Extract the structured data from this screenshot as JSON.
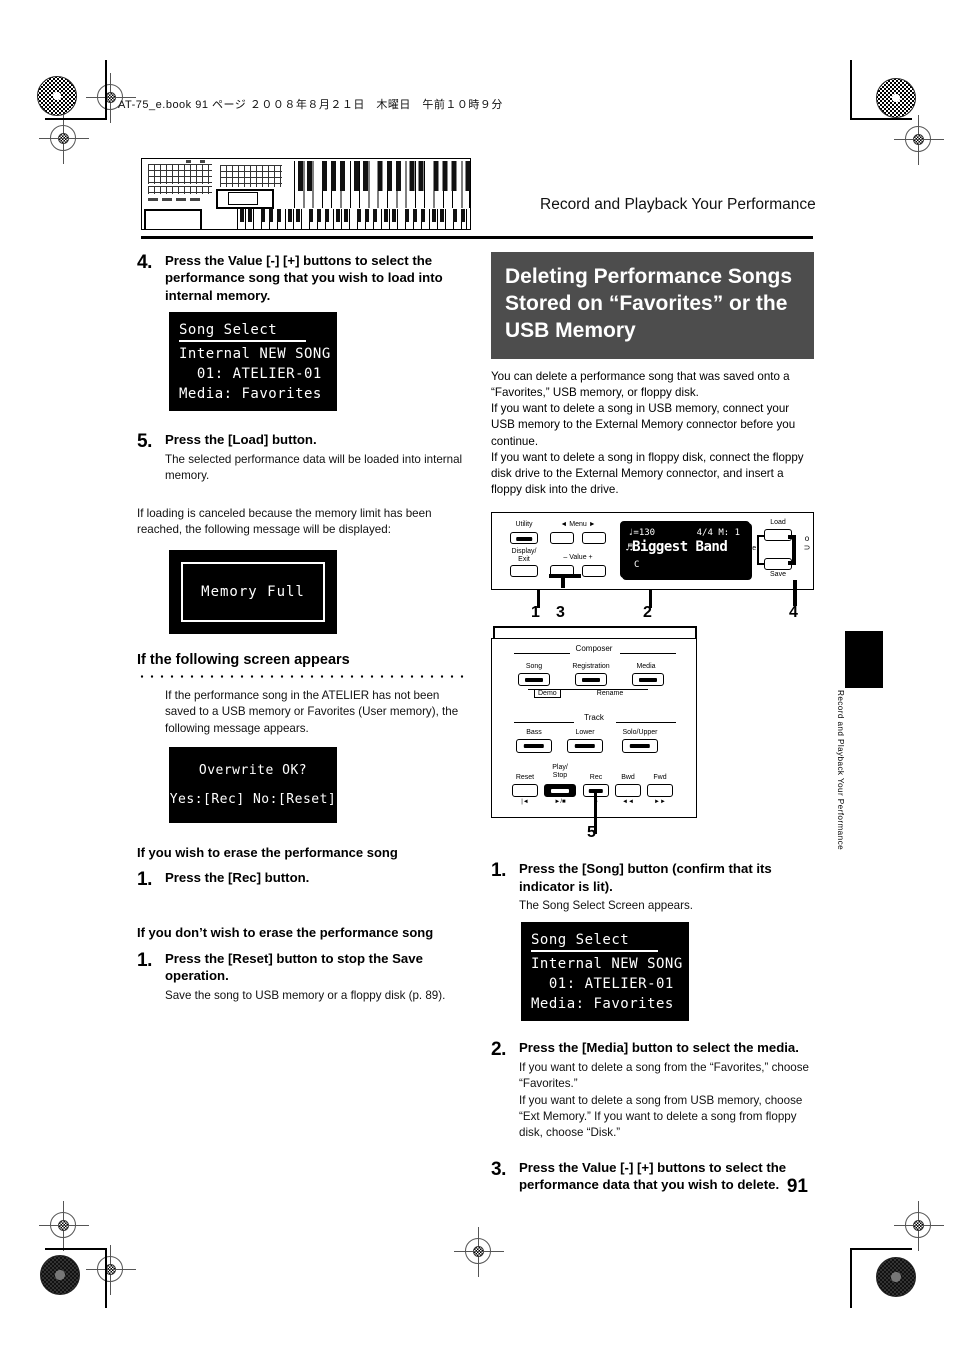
{
  "print_header": "AT-75_e.book 91 ページ ２００８年８月２１日　木曜日　午前１０時９分",
  "running_header": "Record and Playback Your Performance",
  "side_tab_text": "Record and Playback Your Performance",
  "page_number": "91",
  "left_column": {
    "step4": {
      "num": "4.",
      "title": "Press the Value [-] [+] buttons to select the performance song that you wish to load into internal memory."
    },
    "song_select_lcd": {
      "title": "Song Select",
      "line1": "Internal NEW SONG",
      "line2": "  01: ATELIER-01",
      "line3": "Media: Favorites"
    },
    "step5": {
      "num": "5.",
      "title": "Press the [Load] button.",
      "note": "The selected performance data will be loaded into internal memory."
    },
    "memory_full_para": "If loading is canceled because the memory limit has been reached, the following message will be displayed:",
    "memory_full_lcd": "Memory Full",
    "subhead_screen": "If the following screen appears",
    "screen_para": "If the performance song in the ATELIER has not been saved to a USB memory or Favorites (User memory), the following message appears.",
    "overwrite_lcd": {
      "line1": "Overwrite OK?",
      "line2": "Yes:[Rec] No:[Reset]"
    },
    "subhead_erase": "If you wish to erase the performance song",
    "erase_step": {
      "num": "1.",
      "title": "Press the [Rec] button."
    },
    "subhead_noerase": "If you don’t wish to erase the performance song",
    "noerase_step": {
      "num": "1.",
      "title": "Press the [Reset] button to stop the Save operation.",
      "note": "Save the song to USB memory or a floppy disk (p. 89)."
    }
  },
  "right_column": {
    "banner": {
      "line1": "Deleting Performance Songs",
      "line2": "Stored on “Favorites” or the",
      "line3": "USB Memory"
    },
    "intro": {
      "p1": "You can delete a performance song that was saved onto a “Favorites,” USB memory, or floppy disk.",
      "p2": "If you want to delete a song in USB memory, connect your USB memory to the External Memory connector before you continue.",
      "p3": "If you want to delete a song in floppy disk, connect the floppy disk drive to the External Memory connector, and insert a floppy disk into the drive."
    },
    "panel_top": {
      "labels": {
        "utility": "Utility",
        "menu": "Menu",
        "menu_left": "◄",
        "menu_right": "►",
        "display_exit": "Display/\nExit",
        "value": "– Value +",
        "load": "Load",
        "delete": "Delete",
        "save": "Save"
      },
      "lcd": {
        "tempo": "♩=130",
        "beat": "4/4 M:   1",
        "song": "Biggest Band",
        "chord": "C"
      }
    },
    "callouts": [
      "1",
      "3",
      "2",
      "4",
      "5"
    ],
    "panel_bottom": {
      "composer_title": "Composer",
      "composer_buttons": [
        "Song",
        "Registration",
        "Media"
      ],
      "demo_label": "Demo",
      "rename_label": "Rename",
      "track_title": "Track",
      "track_buttons": [
        "Bass",
        "Lower",
        "Solo/Upper"
      ],
      "transport": [
        {
          "label": "Reset",
          "sym": "|◄"
        },
        {
          "label": "Play/\nStop",
          "sym": "►/■"
        },
        {
          "label": "Rec",
          "sym": "●"
        },
        {
          "label": "Bwd",
          "sym": "◄◄"
        },
        {
          "label": "Fwd",
          "sym": "►►"
        }
      ]
    },
    "step1": {
      "num": "1.",
      "title": "Press the [Song] button (confirm that its indicator is lit).",
      "note": "The Song Select Screen appears."
    },
    "song_select_lcd": {
      "title": "Song Select",
      "line1": "Internal NEW SONG",
      "line2": "  01: ATELIER-01",
      "line3": "Media: Favorites"
    },
    "step2": {
      "num": "2.",
      "title": "Press the [Media] button to select the media.",
      "note1": "If you want to delete a song from the “Favorites,” choose “Favorites.”",
      "note2": "If you want to delete a song from USB memory, choose “Ext Memory.” If you want to delete a song from floppy disk, choose “Disk.”"
    },
    "step3": {
      "num": "3.",
      "title": "Press the Value [-] [+] buttons to select the performance data that you wish to delete."
    }
  }
}
